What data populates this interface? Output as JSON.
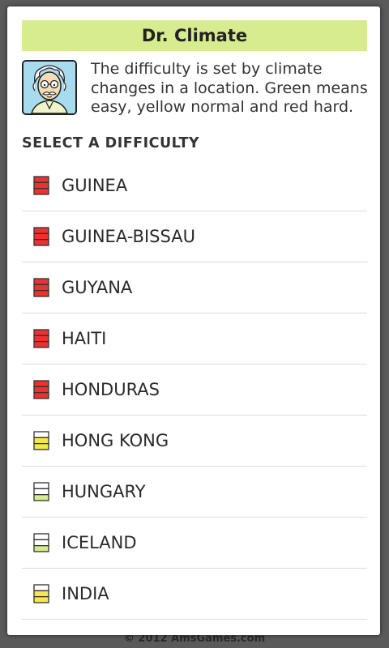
{
  "footer": "© 2012 AmsGames.com",
  "dialog": {
    "title": "Dr. Climate",
    "avatar_name": "dr-climate-avatar",
    "intro": "The difficulty is set by climate changes in a location. Green means easy, yellow normal and red hard.",
    "section_label": "SELECT A DIFFICULTY"
  },
  "difficulty_colors": {
    "hard": "#ee3030",
    "normal": "#f5e84a",
    "easy": "#d6ec8e"
  },
  "locations": [
    {
      "name": "GUINEA",
      "difficulty": "hard"
    },
    {
      "name": "GUINEA-BISSAU",
      "difficulty": "hard"
    },
    {
      "name": "GUYANA",
      "difficulty": "hard"
    },
    {
      "name": "HAITI",
      "difficulty": "hard"
    },
    {
      "name": "HONDURAS",
      "difficulty": "hard"
    },
    {
      "name": "HONG KONG",
      "difficulty": "normal"
    },
    {
      "name": "HUNGARY",
      "difficulty": "easy"
    },
    {
      "name": "ICELAND",
      "difficulty": "easy"
    },
    {
      "name": "INDIA",
      "difficulty": "normal"
    }
  ]
}
